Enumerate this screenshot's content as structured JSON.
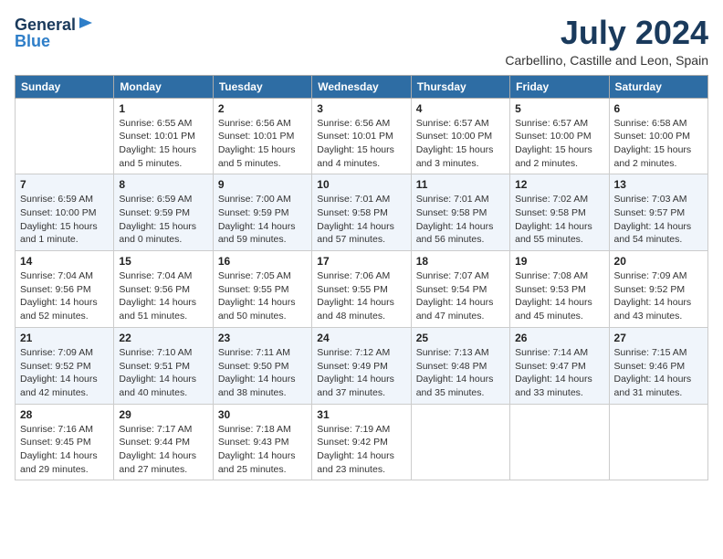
{
  "header": {
    "logo_general": "General",
    "logo_blue": "Blue",
    "month_year": "July 2024",
    "location": "Carbellino, Castille and Leon, Spain"
  },
  "weekdays": [
    "Sunday",
    "Monday",
    "Tuesday",
    "Wednesday",
    "Thursday",
    "Friday",
    "Saturday"
  ],
  "weeks": [
    [
      {
        "day": null,
        "data": null
      },
      {
        "day": "1",
        "data": "Sunrise: 6:55 AM\nSunset: 10:01 PM\nDaylight: 15 hours\nand 5 minutes."
      },
      {
        "day": "2",
        "data": "Sunrise: 6:56 AM\nSunset: 10:01 PM\nDaylight: 15 hours\nand 5 minutes."
      },
      {
        "day": "3",
        "data": "Sunrise: 6:56 AM\nSunset: 10:01 PM\nDaylight: 15 hours\nand 4 minutes."
      },
      {
        "day": "4",
        "data": "Sunrise: 6:57 AM\nSunset: 10:00 PM\nDaylight: 15 hours\nand 3 minutes."
      },
      {
        "day": "5",
        "data": "Sunrise: 6:57 AM\nSunset: 10:00 PM\nDaylight: 15 hours\nand 2 minutes."
      },
      {
        "day": "6",
        "data": "Sunrise: 6:58 AM\nSunset: 10:00 PM\nDaylight: 15 hours\nand 2 minutes."
      }
    ],
    [
      {
        "day": "7",
        "data": "Sunrise: 6:59 AM\nSunset: 10:00 PM\nDaylight: 15 hours\nand 1 minute."
      },
      {
        "day": "8",
        "data": "Sunrise: 6:59 AM\nSunset: 9:59 PM\nDaylight: 15 hours\nand 0 minutes."
      },
      {
        "day": "9",
        "data": "Sunrise: 7:00 AM\nSunset: 9:59 PM\nDaylight: 14 hours\nand 59 minutes."
      },
      {
        "day": "10",
        "data": "Sunrise: 7:01 AM\nSunset: 9:58 PM\nDaylight: 14 hours\nand 57 minutes."
      },
      {
        "day": "11",
        "data": "Sunrise: 7:01 AM\nSunset: 9:58 PM\nDaylight: 14 hours\nand 56 minutes."
      },
      {
        "day": "12",
        "data": "Sunrise: 7:02 AM\nSunset: 9:58 PM\nDaylight: 14 hours\nand 55 minutes."
      },
      {
        "day": "13",
        "data": "Sunrise: 7:03 AM\nSunset: 9:57 PM\nDaylight: 14 hours\nand 54 minutes."
      }
    ],
    [
      {
        "day": "14",
        "data": "Sunrise: 7:04 AM\nSunset: 9:56 PM\nDaylight: 14 hours\nand 52 minutes."
      },
      {
        "day": "15",
        "data": "Sunrise: 7:04 AM\nSunset: 9:56 PM\nDaylight: 14 hours\nand 51 minutes."
      },
      {
        "day": "16",
        "data": "Sunrise: 7:05 AM\nSunset: 9:55 PM\nDaylight: 14 hours\nand 50 minutes."
      },
      {
        "day": "17",
        "data": "Sunrise: 7:06 AM\nSunset: 9:55 PM\nDaylight: 14 hours\nand 48 minutes."
      },
      {
        "day": "18",
        "data": "Sunrise: 7:07 AM\nSunset: 9:54 PM\nDaylight: 14 hours\nand 47 minutes."
      },
      {
        "day": "19",
        "data": "Sunrise: 7:08 AM\nSunset: 9:53 PM\nDaylight: 14 hours\nand 45 minutes."
      },
      {
        "day": "20",
        "data": "Sunrise: 7:09 AM\nSunset: 9:52 PM\nDaylight: 14 hours\nand 43 minutes."
      }
    ],
    [
      {
        "day": "21",
        "data": "Sunrise: 7:09 AM\nSunset: 9:52 PM\nDaylight: 14 hours\nand 42 minutes."
      },
      {
        "day": "22",
        "data": "Sunrise: 7:10 AM\nSunset: 9:51 PM\nDaylight: 14 hours\nand 40 minutes."
      },
      {
        "day": "23",
        "data": "Sunrise: 7:11 AM\nSunset: 9:50 PM\nDaylight: 14 hours\nand 38 minutes."
      },
      {
        "day": "24",
        "data": "Sunrise: 7:12 AM\nSunset: 9:49 PM\nDaylight: 14 hours\nand 37 minutes."
      },
      {
        "day": "25",
        "data": "Sunrise: 7:13 AM\nSunset: 9:48 PM\nDaylight: 14 hours\nand 35 minutes."
      },
      {
        "day": "26",
        "data": "Sunrise: 7:14 AM\nSunset: 9:47 PM\nDaylight: 14 hours\nand 33 minutes."
      },
      {
        "day": "27",
        "data": "Sunrise: 7:15 AM\nSunset: 9:46 PM\nDaylight: 14 hours\nand 31 minutes."
      }
    ],
    [
      {
        "day": "28",
        "data": "Sunrise: 7:16 AM\nSunset: 9:45 PM\nDaylight: 14 hours\nand 29 minutes."
      },
      {
        "day": "29",
        "data": "Sunrise: 7:17 AM\nSunset: 9:44 PM\nDaylight: 14 hours\nand 27 minutes."
      },
      {
        "day": "30",
        "data": "Sunrise: 7:18 AM\nSunset: 9:43 PM\nDaylight: 14 hours\nand 25 minutes."
      },
      {
        "day": "31",
        "data": "Sunrise: 7:19 AM\nSunset: 9:42 PM\nDaylight: 14 hours\nand 23 minutes."
      },
      {
        "day": null,
        "data": null
      },
      {
        "day": null,
        "data": null
      },
      {
        "day": null,
        "data": null
      }
    ]
  ]
}
